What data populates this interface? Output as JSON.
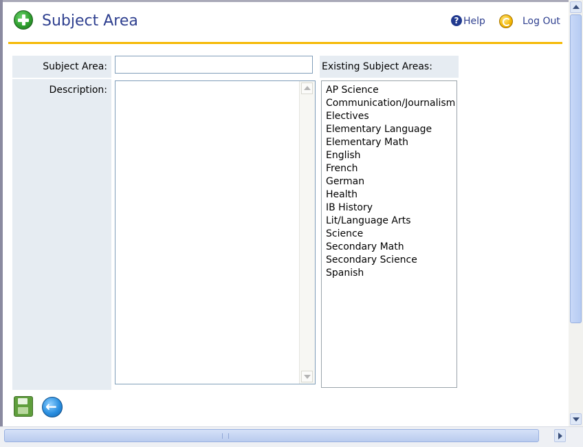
{
  "header": {
    "title": "Subject Area",
    "help_label": "Help",
    "logout_label": "Log Out"
  },
  "form": {
    "subject_area_label": "Subject Area:",
    "subject_area_value": "",
    "description_label": "Description:",
    "description_value": ""
  },
  "existing": {
    "header": "Existing Subject Areas:",
    "items": [
      "AP Science",
      "Communication/Journalism",
      "Electives",
      "Elementary Language",
      "Elementary Math",
      "English",
      "French",
      "German",
      "Health",
      "IB History",
      "Lit/Language Arts",
      "Science",
      "Secondary Math",
      "Secondary Science",
      "Spanish"
    ]
  },
  "icons": {
    "add": "add-icon",
    "help": "help-icon",
    "logout": "logout-icon",
    "save": "save-icon",
    "back": "back-icon"
  },
  "colors": {
    "title": "#2e3f8f",
    "accent_rule": "#f5b800",
    "label_bg": "#e6ecf2"
  }
}
